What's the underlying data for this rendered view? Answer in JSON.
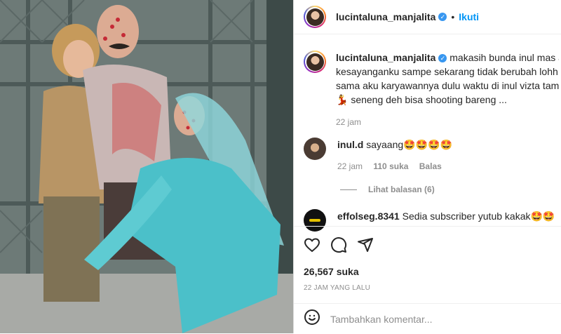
{
  "post": {
    "username": "lucintaluna_manjalita",
    "follow_label": "Ikuti",
    "dot": "•",
    "caption_lines": [
      "makasih bunda inul mas adam",
      "kesayanganku sampe sekarang tidak berubah lohh ... s",
      "sama aku karyawannya dulu waktu di inul vizta taman",
      "💃 seneng deh bisa shooting bareng ..."
    ],
    "caption_time": "22 jam"
  },
  "comments": [
    {
      "username": "inul.d",
      "text": "sayaang🤩🤩🤩🤩",
      "time": "22 jam",
      "likes": "110 suka",
      "reply_label": "Balas",
      "view_replies": "Lihat balasan (6)"
    },
    {
      "username": "effolseg.8341",
      "text": "Sedia subscriber yutub kakak🤩🤩"
    }
  ],
  "actions": {
    "icons": [
      "heart-icon",
      "comment-icon",
      "share-icon"
    ],
    "likes_count": "26,567 suka",
    "posted_time": "22 JAM YANG LALU"
  },
  "comment_box": {
    "placeholder": "Tambahkan komentar..."
  },
  "colors": {
    "accent": "#0095f6",
    "verified": "#3897f0",
    "muted": "#8e8e8e"
  }
}
